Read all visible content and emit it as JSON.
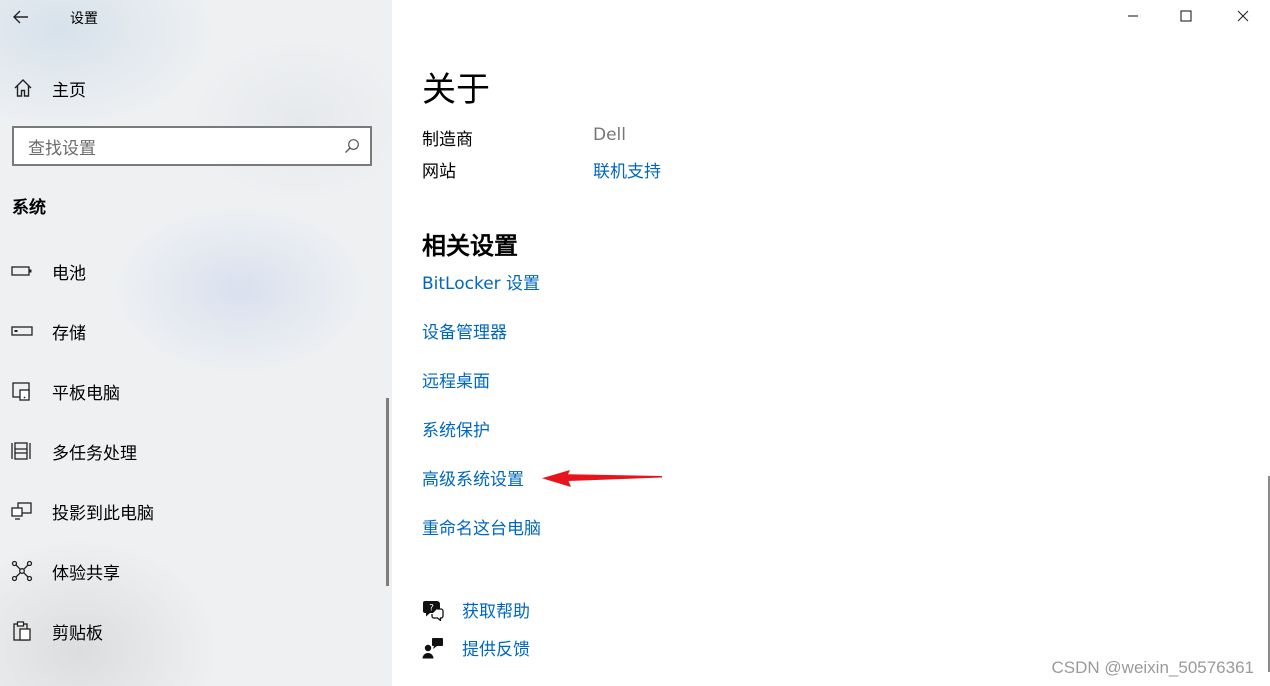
{
  "window": {
    "title": "设置",
    "controls": [
      "minimize-icon",
      "maximize-icon",
      "close-icon"
    ]
  },
  "sidebar": {
    "home_label": "主页",
    "search_placeholder": "查找设置",
    "section_title": "系统",
    "items": [
      {
        "label": "电池",
        "icon": "battery-icon"
      },
      {
        "label": "存储",
        "icon": "storage-icon"
      },
      {
        "label": "平板电脑",
        "icon": "tablet-icon"
      },
      {
        "label": "多任务处理",
        "icon": "multitasking-icon"
      },
      {
        "label": "投影到此电脑",
        "icon": "projecting-icon"
      },
      {
        "label": "体验共享",
        "icon": "shared-experiences-icon"
      },
      {
        "label": "剪贴板",
        "icon": "clipboard-icon"
      }
    ]
  },
  "main": {
    "title": "关于",
    "info": {
      "manufacturer_label": "制造商",
      "manufacturer_value": "Dell",
      "website_label": "网站",
      "website_value": "联机支持"
    },
    "related": {
      "title": "相关设置",
      "links": [
        "BitLocker 设置",
        "设备管理器",
        "远程桌面",
        "系统保护",
        "高级系统设置",
        "重命名这台电脑"
      ]
    },
    "help": {
      "get_help": "获取帮助",
      "give_feedback": "提供反馈"
    }
  },
  "annotation": {
    "arrow_color": "#e8141c",
    "points_to": "高级系统设置"
  },
  "colors": {
    "link": "#0067c0",
    "dim_text": "#767676"
  },
  "watermark": "CSDN @weixin_50576361"
}
